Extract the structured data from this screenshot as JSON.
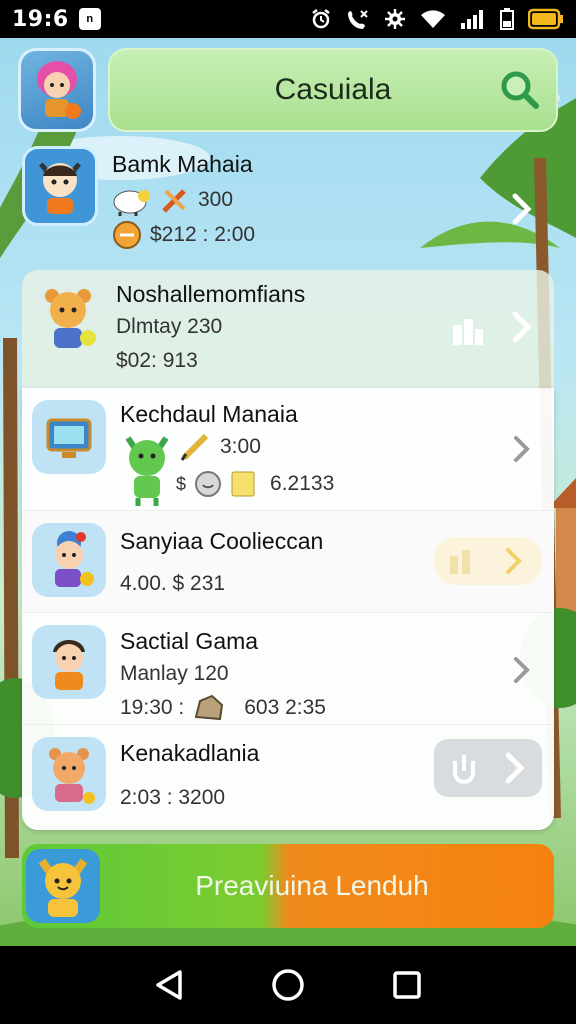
{
  "status_bar": {
    "time": "19:6",
    "notif_glyph": "n",
    "icons": [
      "alarm-icon",
      "call-icon",
      "settings-icon",
      "wifi-icon",
      "signal-icon",
      "battery-low-icon",
      "battery-icon"
    ]
  },
  "header": {
    "title": "Casuiala",
    "search_icon": "search-icon",
    "accent": "#2f9a4a"
  },
  "cards": [
    {
      "title": "Bamk Mahaia",
      "line1": "300",
      "line2": "$212 : 2:00"
    },
    {
      "title": "Noshallemomfians",
      "line1": "Dlmtay 230",
      "line2": "$02: 913"
    },
    {
      "title": "Kechdaul Manaia",
      "line1": "3:00",
      "line2_prefix": "$",
      "line2": "6.2133"
    },
    {
      "title": "Sanyiaa Coolieccan",
      "line1": "4.00. $ 231"
    },
    {
      "title": "Sactial Gama",
      "line1": "Manlay 120",
      "line2_a": "19:30 :",
      "line2_b": "603 2:35"
    },
    {
      "title": "Kenakadlania",
      "line1": "2:03 : 3200"
    }
  ],
  "bottom_button": {
    "label": "Preaviuina Lenduh"
  },
  "nav": {
    "back": "back-icon",
    "home": "home-icon",
    "recents": "recents-icon"
  }
}
